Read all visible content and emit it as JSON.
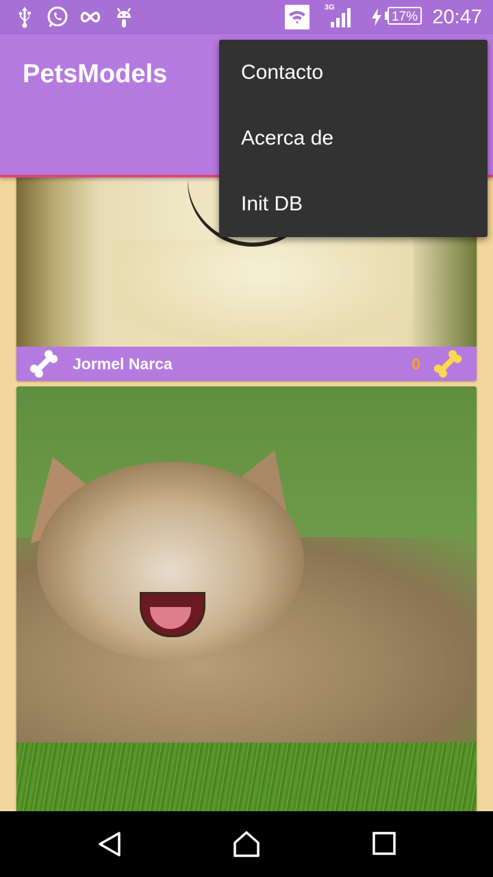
{
  "status_bar": {
    "time": "20:47",
    "battery": "17%",
    "network": "3G",
    "icons": [
      "usb-icon",
      "whatsapp-icon",
      "infinity-icon",
      "android-icon",
      "wifi-icon",
      "signal-icon",
      "charging-icon",
      "battery-icon"
    ]
  },
  "toolbar": {
    "title": "PetsModels",
    "color": "#b57ae0"
  },
  "overflow_menu": {
    "items": [
      {
        "label": "Contacto"
      },
      {
        "label": "Acerca de"
      },
      {
        "label": "Init DB"
      }
    ]
  },
  "cards": [
    {
      "name": "Jormel Narca",
      "likes": "0",
      "photo": "dog-photo"
    },
    {
      "photo": "cat-photo"
    }
  ],
  "colors": {
    "accent": "#e0457b",
    "background": "#f2d69b",
    "like_count": "#f3a715",
    "bone": "#fcd74f"
  },
  "nav_bar": {
    "buttons": [
      "back-icon",
      "home-icon",
      "recents-icon"
    ]
  }
}
